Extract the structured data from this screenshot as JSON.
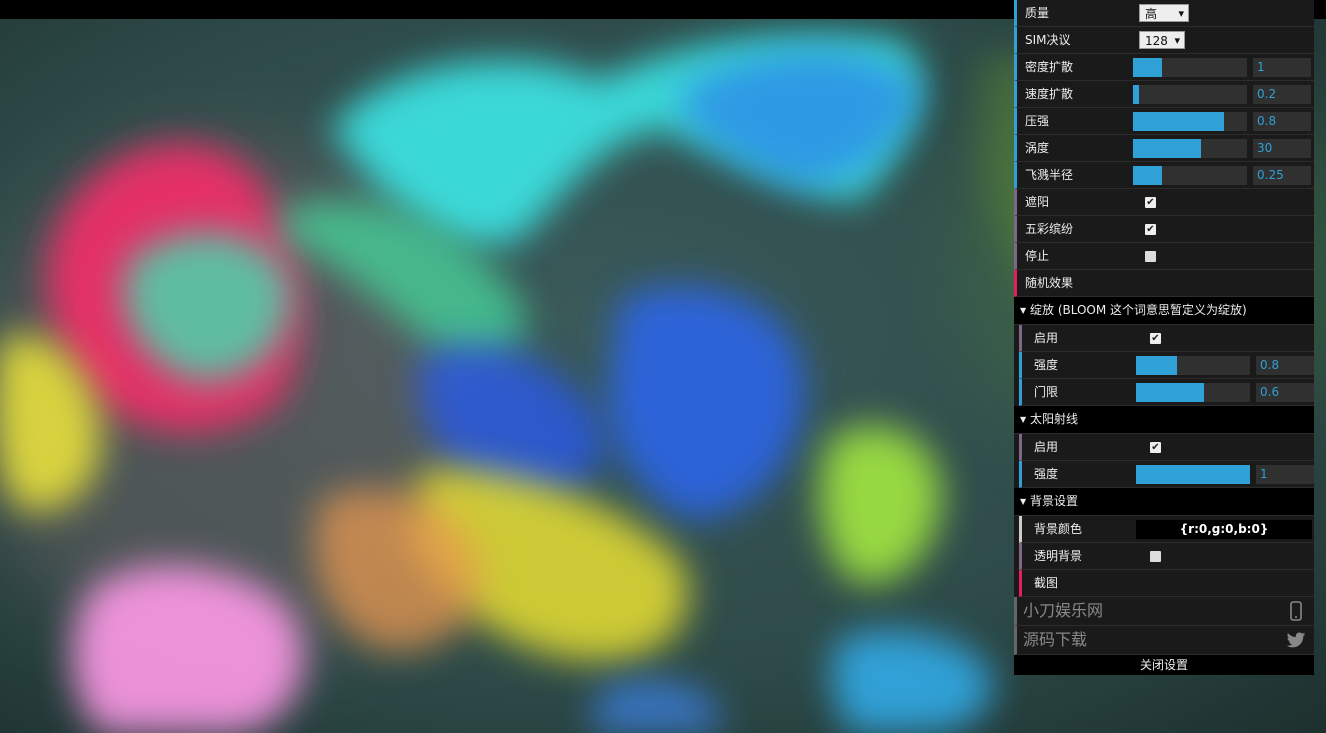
{
  "gui": {
    "quality": {
      "label": "质量",
      "value": "高"
    },
    "sim_resolution": {
      "label": "SIM决议",
      "value": "128"
    },
    "density_diffusion": {
      "label": "密度扩散",
      "value": "1",
      "fraction": 0.25
    },
    "velocity_diffusion": {
      "label": "速度扩散",
      "value": "0.2",
      "fraction": 0.05
    },
    "pressure": {
      "label": "压强",
      "value": "0.8",
      "fraction": 0.8
    },
    "curl": {
      "label": "涡度",
      "value": "30",
      "fraction": 0.6
    },
    "splat_radius": {
      "label": "飞溅半径",
      "value": "0.25",
      "fraction": 0.25
    },
    "shading": {
      "label": "遮阳",
      "checked": true
    },
    "colorful": {
      "label": "五彩缤纷",
      "checked": true
    },
    "paused": {
      "label": "停止",
      "checked": false
    },
    "random_splats": {
      "label": "随机效果"
    },
    "bloom_folder": {
      "label": "绽放 (BLOOM 这个词意思暂定义为绽放)"
    },
    "bloom_enabled": {
      "label": "启用",
      "checked": true
    },
    "bloom_intensity": {
      "label": "强度",
      "value": "0.8",
      "fraction": 0.36
    },
    "bloom_threshold": {
      "label": "门限",
      "value": "0.6",
      "fraction": 0.6
    },
    "sunrays_folder": {
      "label": "太阳射线"
    },
    "sunrays_enabled": {
      "label": "启用",
      "checked": true
    },
    "sunrays_weight": {
      "label": "强度",
      "value": "1",
      "fraction": 1.0
    },
    "background_folder": {
      "label": "背景设置"
    },
    "background_color": {
      "label": "背景颜色",
      "value": "{r:0,g:0,b:0}"
    },
    "transparent": {
      "label": "透明背景",
      "checked": false
    },
    "capture": {
      "label": "截图"
    },
    "link_site": {
      "label": "小刀娱乐网",
      "icon": "phone-icon"
    },
    "link_source": {
      "label": "源码下载",
      "icon": "twitter-icon"
    },
    "close": {
      "label": "关闭设置"
    }
  },
  "colors": {
    "accent": "#2fa1d6",
    "panel_bg": "#1a1a1a",
    "function_border": "#e61d5f"
  }
}
